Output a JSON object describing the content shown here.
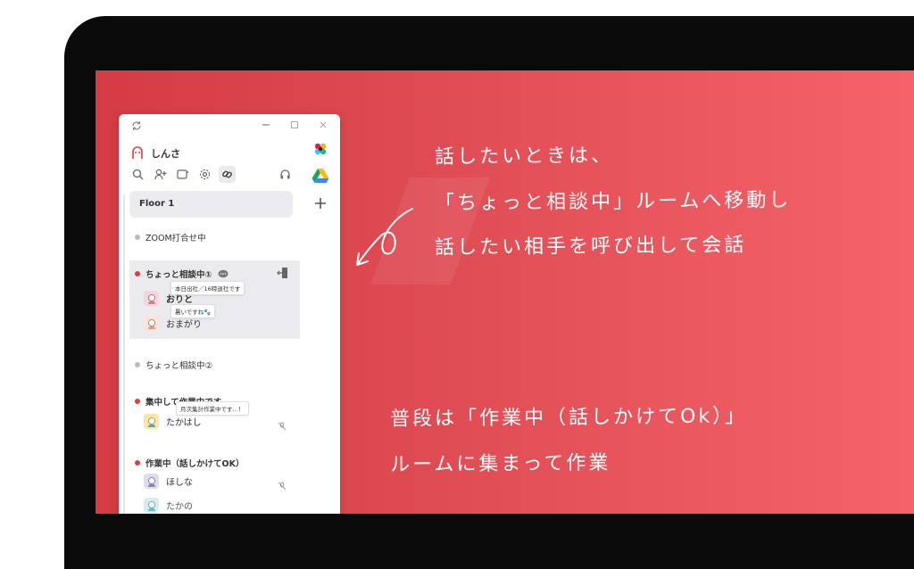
{
  "app": {
    "user_name": "しんさ",
    "floor_label": "Floor 1",
    "rooms": [
      {
        "name": "ZOOM打合せ中",
        "status": "grey"
      },
      {
        "name": "ちょっと相談中①",
        "status": "red"
      },
      {
        "name": "ちょっと相談中②",
        "status": "grey"
      },
      {
        "name": "集中して作業中です",
        "status": "red"
      },
      {
        "name": "作業中（話しかけてOK）",
        "status": "red"
      }
    ],
    "members": {
      "orito": "おりと",
      "omagari": "おまがり",
      "takahashi": "たかはし",
      "hoshina": "ほしな",
      "takano": "たかの"
    },
    "bubbles": {
      "orito_status": "本日出社／16時退社です",
      "omagari_status": "暑いですね🐾",
      "takahashi_status": "月次集計作業中です…！"
    }
  },
  "annotations": {
    "top_line1": "話したいときは、",
    "top_line2": "「ちょっと相談中」ルームへ移動し",
    "top_line3": "話したい相手を呼び出して会話",
    "bottom_line1": "普段は「作業中（話しかけてOk）」",
    "bottom_line2": "ルームに集まって作業"
  },
  "colors": {
    "accent_red": "#e23b3b",
    "screen_gradient_start": "#d63b44",
    "screen_gradient_end": "#f5636a"
  }
}
